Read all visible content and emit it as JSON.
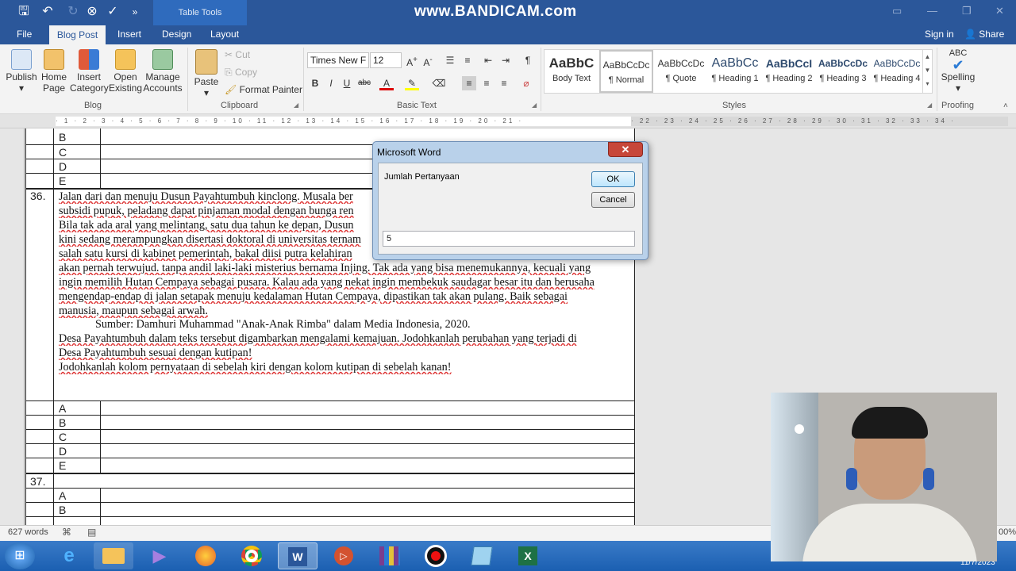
{
  "recording_watermark": "www.BANDICAM.com",
  "titlebar": {
    "contextual_tab": "Table Tools"
  },
  "tabs": [
    "File",
    "Blog Post",
    "Insert",
    "Design",
    "Layout"
  ],
  "account": {
    "sign_in": "Sign in",
    "share": "Share"
  },
  "ribbon": {
    "blog": {
      "label": "Blog",
      "buttons": [
        {
          "line1": "Publish",
          "line2": "▾"
        },
        {
          "line1": "Home",
          "line2": "Page"
        },
        {
          "line1": "Insert",
          "line2": "Category"
        },
        {
          "line1": "Open",
          "line2": "Existing"
        },
        {
          "line1": "Manage",
          "line2": "Accounts"
        }
      ]
    },
    "clipboard": {
      "label": "Clipboard",
      "paste": "Paste",
      "cut": "Cut",
      "copy": "Copy",
      "format_painter": "Format Painter"
    },
    "basic_text": {
      "label": "Basic Text",
      "font_name": "Times New F",
      "font_size": "12"
    },
    "styles": {
      "label": "Styles",
      "items": [
        {
          "preview": "AaBbC",
          "name": "Body Text"
        },
        {
          "preview": "AaBbCcDc",
          "name": "¶ Normal"
        },
        {
          "preview": "AaBbCcDc",
          "name": "¶ Quote"
        },
        {
          "preview": "AaBbCc",
          "name": "¶ Heading 1"
        },
        {
          "preview": "AaBbCcI",
          "name": "¶ Heading 2"
        },
        {
          "preview": "AaBbCcDc",
          "name": "¶ Heading 3"
        },
        {
          "preview": "AaBbCcDc",
          "name": "¶ Heading 4"
        }
      ]
    },
    "proofing": {
      "label": "Proofing",
      "spelling": "Spelling",
      "abc": "ABC"
    }
  },
  "ruler": {
    "marks": "· 1 · 2 · 3 · 4 · 5 · 6 · 7 · 8 · 9 · 10 · 11 · 12 · 13 · 14 · 15 · 16 · 17 · 18 · 19 · 20 · 21 ·",
    "marks_gray": "· 22 · 23 · 24 · 25 · 26 · 27 · 28 · 29 · 30 · 31 · 32 · 33 · 34 ·"
  },
  "document": {
    "top_letters": [
      "B",
      "C",
      "D",
      "E"
    ],
    "question_36": {
      "number": "36.",
      "lines": [
        "Jalan dari dan menuju Dusun Payahtumbuh kinclong. Musala ber",
        "subsidi pupuk, peladang dapat pinjaman modal dengan bunga ren",
        "Bila tak ada aral yang melintang, satu dua tahun ke depan, Dusun",
        "kini sedang merampungkan disertasi doktoral di universitas ternam",
        "salah satu kursi di kabinet pemerintah, bakal diisi putra kelahiran",
        "akan pernah terwujud. tanpa andil laki-laki misterius bernama Injing. Tak ada yang bisa menemukannya, kecuali yang",
        "ingin memilih Hutan Cempaya sebagai pusara. Kalau ada yang nekat ingin membekuk saudagar besar itu dan berusaha",
        "mengendap-endap di jalan setapak menuju kedalaman Hutan Cempaya, dipastikan tak akan pulang. Baik sebagai",
        "manusia, maupun sebagai arwah."
      ],
      "source": "Sumber: Damhuri Muhammad \"Anak-Anak Rimba\" dalam  Media Indonesia, 2020.",
      "instruction_lines": [
        "Desa Payahtumbuh dalam teks tersebut digambarkan mengalami kemajuan. Jodohkanlah perubahan yang terjadi di",
        "Desa Payahtumbuh sesuai dengan kutipan!",
        "Jodohkanlah kolom pernyataan di sebelah kiri dengan kolom kutipan di sebelah kanan!"
      ],
      "letters": [
        "A",
        "B",
        "C",
        "D",
        "E"
      ]
    },
    "question_37": {
      "number": "37.",
      "letters": [
        "A",
        "B"
      ]
    }
  },
  "dialog": {
    "title": "Microsoft Word",
    "prompt": "Jumlah Pertanyaan",
    "ok": "OK",
    "cancel": "Cancel",
    "input_value": "5"
  },
  "statusbar": {
    "word_count": "627 words",
    "zoom_fragment": "00%"
  },
  "taskbar": {
    "date": "11/7/2023",
    "apps": [
      "start",
      "internet-explorer",
      "file-explorer",
      "visual-studio",
      "firefox",
      "chrome",
      "word",
      "powerpoint",
      "winrar",
      "bandicam-record",
      "notepad",
      "excel"
    ]
  }
}
